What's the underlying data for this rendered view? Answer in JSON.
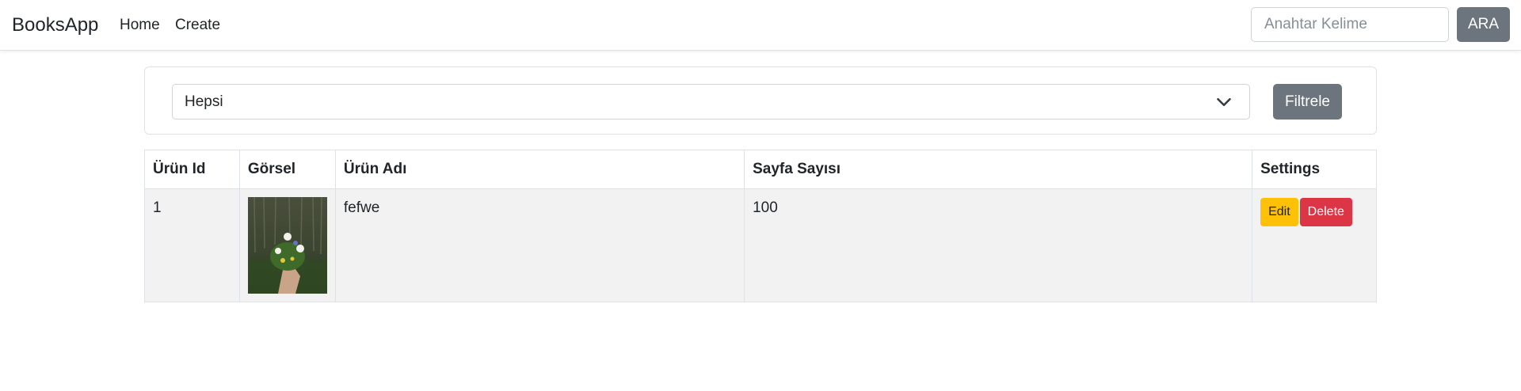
{
  "navbar": {
    "brand": "BooksApp",
    "links": [
      "Home",
      "Create"
    ],
    "search_placeholder": "Anahtar Kelime",
    "search_button": "ARA"
  },
  "filter": {
    "selected": "Hepsi",
    "button": "Filtrele"
  },
  "table": {
    "headers": [
      "Ürün Id",
      "Görsel",
      "Ürün Adı",
      "Sayfa Sayısı",
      "Settings"
    ],
    "rows": [
      {
        "id": "1",
        "image": "flower-bouquet-photo",
        "name": "fefwe",
        "pages": "100",
        "edit_label": "Edit",
        "delete_label": "Delete"
      }
    ]
  },
  "colors": {
    "secondary": "#6c757d",
    "warning": "#ffc107",
    "danger": "#dc3545",
    "row_bg": "#f2f2f2"
  }
}
